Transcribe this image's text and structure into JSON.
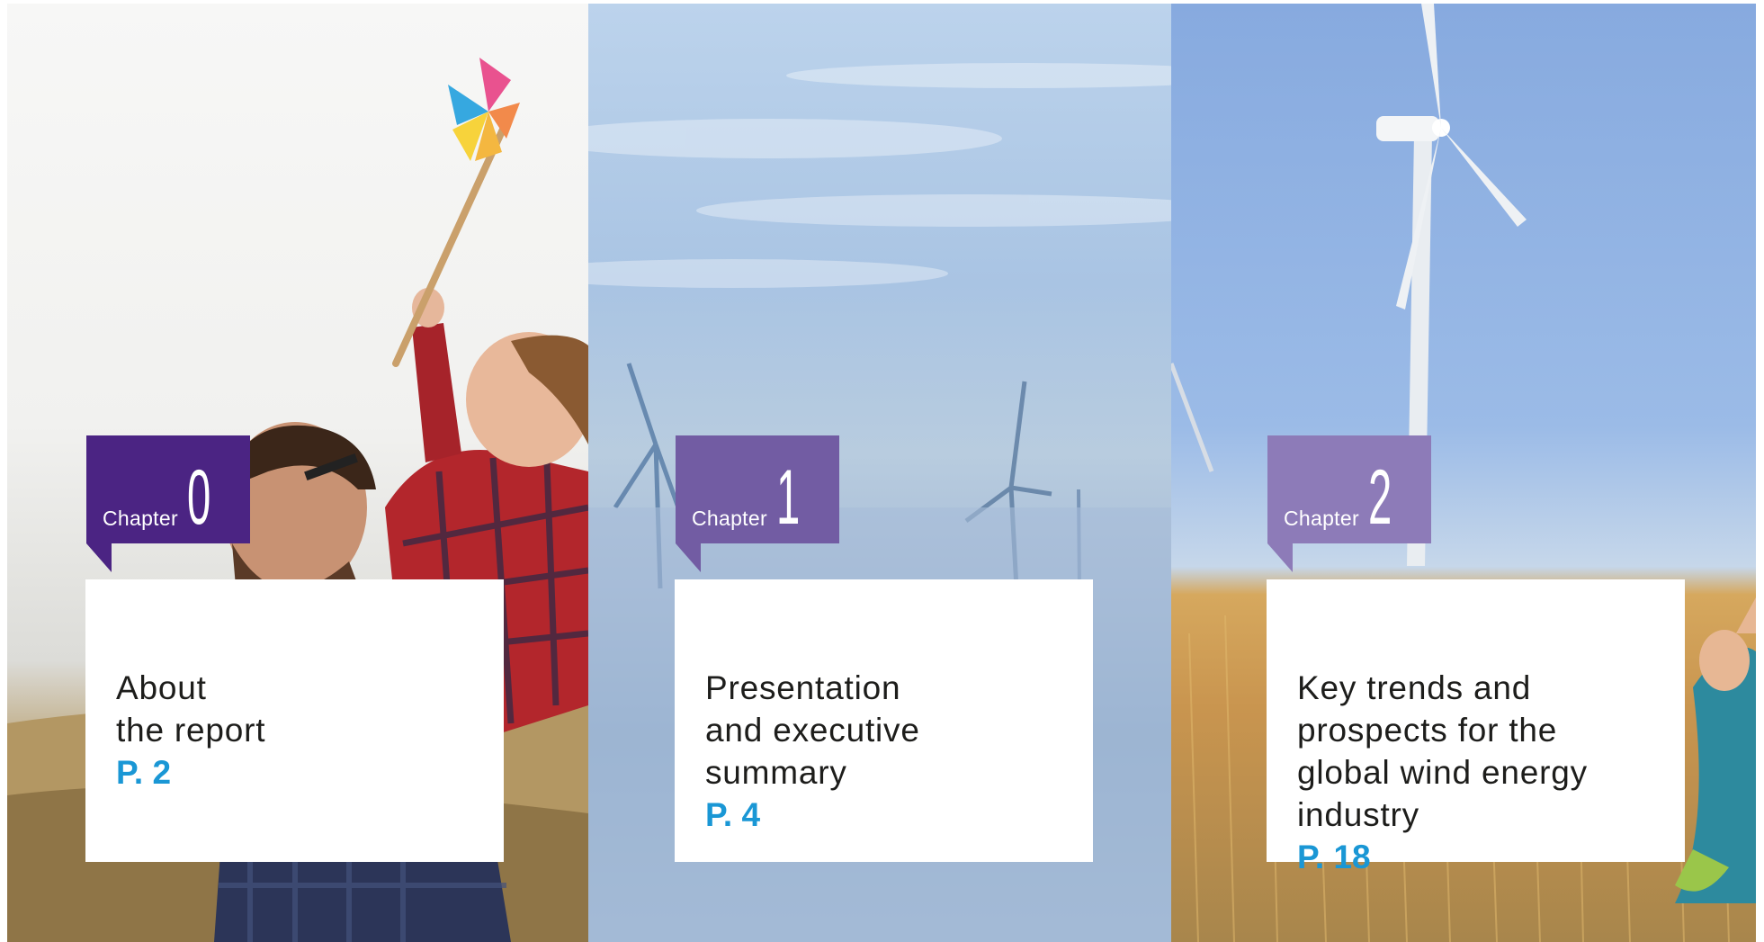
{
  "chapters": [
    {
      "word": "Chapter",
      "number": "0",
      "title": "About\nthe report",
      "page": "P. 2",
      "tab_color": "#4b2483"
    },
    {
      "word": "Chapter",
      "number": "1",
      "title": "Presentation\nand executive\nsummary",
      "page": "P. 4",
      "tab_color": "#725ca3"
    },
    {
      "word": "Chapter",
      "number": "2",
      "title": "Key trends and\nprospects for the\nglobal wind energy\nindustry",
      "page": "P. 18",
      "tab_color": "#8d7bb8"
    }
  ],
  "accent_color": "#1a97d5"
}
